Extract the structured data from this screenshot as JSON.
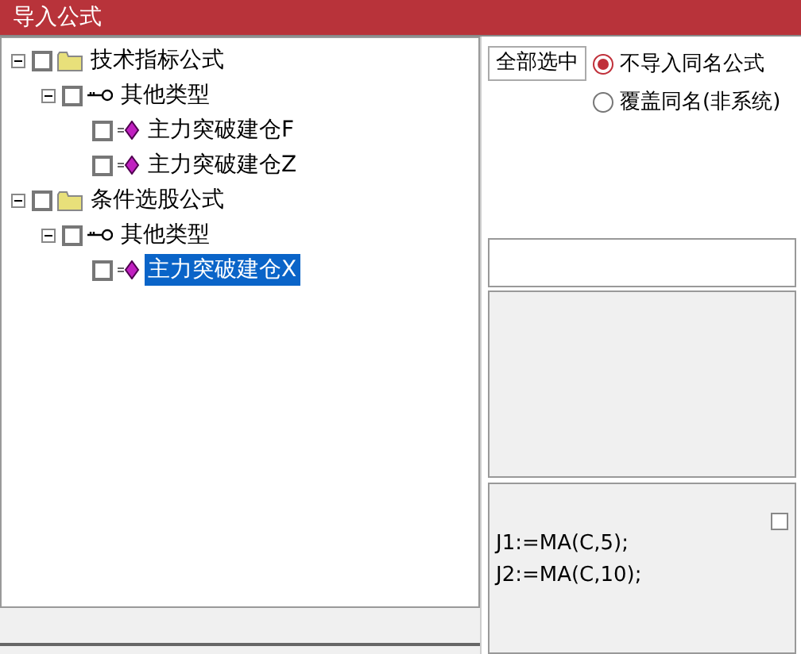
{
  "window": {
    "title": "导入公式"
  },
  "tree": [
    {
      "label": "技术指标公式",
      "kind": "folder",
      "checked": false,
      "expanded": true,
      "selected": false,
      "children": [
        {
          "label": "其他类型",
          "kind": "type",
          "checked": false,
          "expanded": true,
          "selected": false,
          "children": [
            {
              "label": "主力突破建仓F",
              "kind": "formula",
              "checked": false,
              "selected": false
            },
            {
              "label": "主力突破建仓Z",
              "kind": "formula",
              "checked": false,
              "selected": false
            }
          ]
        }
      ]
    },
    {
      "label": "条件选股公式",
      "kind": "folder",
      "checked": false,
      "expanded": true,
      "selected": false,
      "children": [
        {
          "label": "其他类型",
          "kind": "type",
          "checked": false,
          "expanded": true,
          "selected": false,
          "children": [
            {
              "label": "主力突破建仓X",
              "kind": "formula",
              "checked": false,
              "selected": true
            }
          ]
        }
      ]
    }
  ],
  "select_all_button": "全部选中",
  "options": [
    {
      "label": "不导入同名公式",
      "selected": true
    },
    {
      "label": "覆盖同名(非系统)",
      "selected": false
    }
  ],
  "code": {
    "lines": [
      "J1:=MA(C,5);",
      "J2:=MA(C,10);"
    ],
    "checked": false
  }
}
